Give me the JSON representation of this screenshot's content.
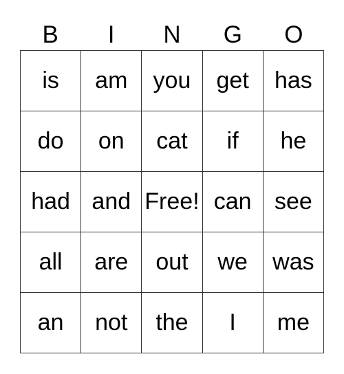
{
  "header": [
    "B",
    "I",
    "N",
    "G",
    "O"
  ],
  "cells": [
    [
      "is",
      "am",
      "you",
      "get",
      "has"
    ],
    [
      "do",
      "on",
      "cat",
      "if",
      "he"
    ],
    [
      "had",
      "and",
      "Free!",
      "can",
      "see"
    ],
    [
      "all",
      "are",
      "out",
      "we",
      "was"
    ],
    [
      "an",
      "not",
      "the",
      "I",
      "me"
    ]
  ]
}
